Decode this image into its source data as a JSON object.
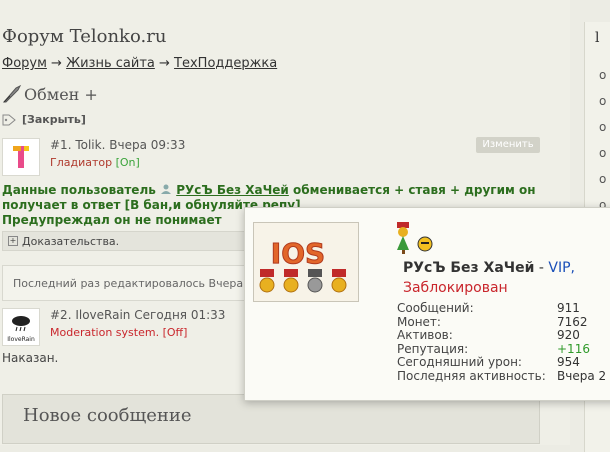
{
  "forum": {
    "title": "Форум Telonko.ru"
  },
  "breadcrumb": {
    "items": [
      "Форум",
      "Жизнь сайта",
      "ТехПоддержка"
    ],
    "sep": "→"
  },
  "topic": {
    "title": "Обмен +",
    "tag": "[Закрыть]"
  },
  "post1": {
    "num": "#1.",
    "author": "Tolik.",
    "time": "Вчера 09:33",
    "role": "Гладиатор",
    "status": "[On]",
    "edit_label": "Изменить",
    "text_part1": "Данные пользователь",
    "text_user": "РУсЪ Без ХаЧей",
    "text_part2": "обменивается + ставя + другим он получает в ответ [В бан,и обнуляйте репу]",
    "text_line3": "Предупреждал он не понимает",
    "spoiler": "Доказательства.",
    "last_edit": "Последний раз редактировалось Вчера"
  },
  "post2": {
    "num": "#2.",
    "author": "IloveRain",
    "time": "Сегодня 01:33",
    "role": "Moderation system.",
    "status": "[Off]",
    "avatar_text": "IloveRain",
    "text": "Наказан."
  },
  "new_message": {
    "title": "Новое сообщение"
  },
  "sidebar": {
    "title": "l",
    "items": [
      "о",
      "о",
      "о",
      "о",
      "о",
      "о",
      "о"
    ]
  },
  "popup": {
    "avatar_text": "IOS",
    "name": "РУсЪ Без ХаЧей",
    "separator": " - ",
    "group": "VIP,",
    "status": "Заблокирован",
    "stats": [
      {
        "label": "Сообщений:",
        "value": "911"
      },
      {
        "label": "Монет:",
        "value": "7162"
      },
      {
        "label": "Активов:",
        "value": "920"
      },
      {
        "label": "Репутация:",
        "value": "+116"
      },
      {
        "label": "Сегодняшний урон:",
        "value": "954"
      },
      {
        "label": "Последняя активность:",
        "value": "Вчера 2"
      }
    ]
  },
  "colors": {
    "role_gladiator": "#b03a2e",
    "online": "#3aa33a",
    "moderation": "#c9262c",
    "vip": "#1a4fb8",
    "post_text": "#2c6e1e"
  }
}
